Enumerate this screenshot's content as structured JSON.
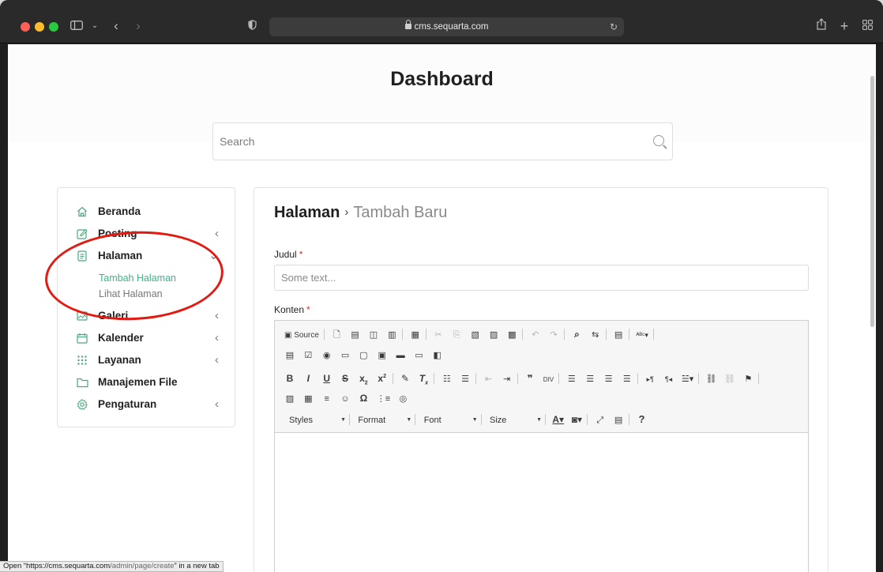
{
  "browser": {
    "url": "cms.sequarta.com",
    "status_prefix": "Open “",
    "status_url_host": "https://cms.sequarta.com",
    "status_url_path": "/admin/page/create",
    "status_suffix": "” in a new tab"
  },
  "page": {
    "title": "Dashboard",
    "search_placeholder": "Search"
  },
  "sidebar": {
    "items": [
      {
        "label": "Beranda",
        "icon": "home-icon",
        "chevron": ""
      },
      {
        "label": "Posting",
        "icon": "edit-icon",
        "chevron": "‹"
      },
      {
        "label": "Halaman",
        "icon": "page-icon",
        "chevron": "⌄"
      },
      {
        "label": "Galeri",
        "icon": "image-icon",
        "chevron": "‹"
      },
      {
        "label": "Kalender",
        "icon": "calendar-icon",
        "chevron": "‹"
      },
      {
        "label": "Layanan",
        "icon": "grid-icon",
        "chevron": "‹"
      },
      {
        "label": "Manajemen File",
        "icon": "folder-icon",
        "chevron": ""
      },
      {
        "label": "Pengaturan",
        "icon": "gear-icon",
        "chevron": "‹"
      }
    ],
    "subitems": [
      {
        "label": "Tambah Halaman",
        "active": true
      },
      {
        "label": "Lihat Halaman",
        "active": false
      }
    ]
  },
  "main": {
    "breadcrumb_root": "Halaman",
    "breadcrumb_sep": "›",
    "breadcrumb_current": "Tambah Baru",
    "judul_label": "Judul",
    "judul_placeholder": "Some text...",
    "konten_label": "Konten",
    "required_mark": "*"
  },
  "editor": {
    "source_label": "Source",
    "combos": [
      "Styles",
      "Format",
      "Font",
      "Size"
    ],
    "help": "?"
  },
  "colors": {
    "accent": "#3eb489",
    "required": "#d9302c",
    "annotation": "#e21b12"
  }
}
